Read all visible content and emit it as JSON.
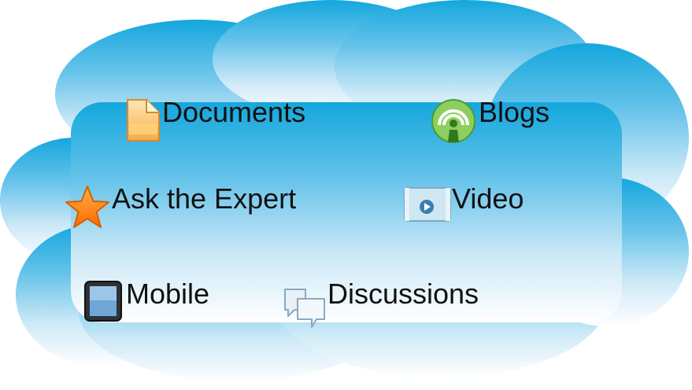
{
  "links": {
    "documents": {
      "label": "Documents",
      "icon": "document-icon"
    },
    "blogs": {
      "label": "Blogs",
      "icon": "podcast-icon"
    },
    "ask_the_expert": {
      "label": "Ask the Expert",
      "icon": "star-icon"
    },
    "video": {
      "label": "Video",
      "icon": "video-icon"
    },
    "mobile": {
      "label": "Mobile",
      "icon": "tablet-icon"
    },
    "discussions": {
      "label": "Discussions",
      "icon": "chat-bubbles-icon"
    }
  },
  "colors": {
    "cloud_top": "#1aa8dc",
    "cloud_bottom": "#ffffff",
    "text": "#111111",
    "star": "#ff8c1a",
    "blog_green": "#5fae3a"
  }
}
